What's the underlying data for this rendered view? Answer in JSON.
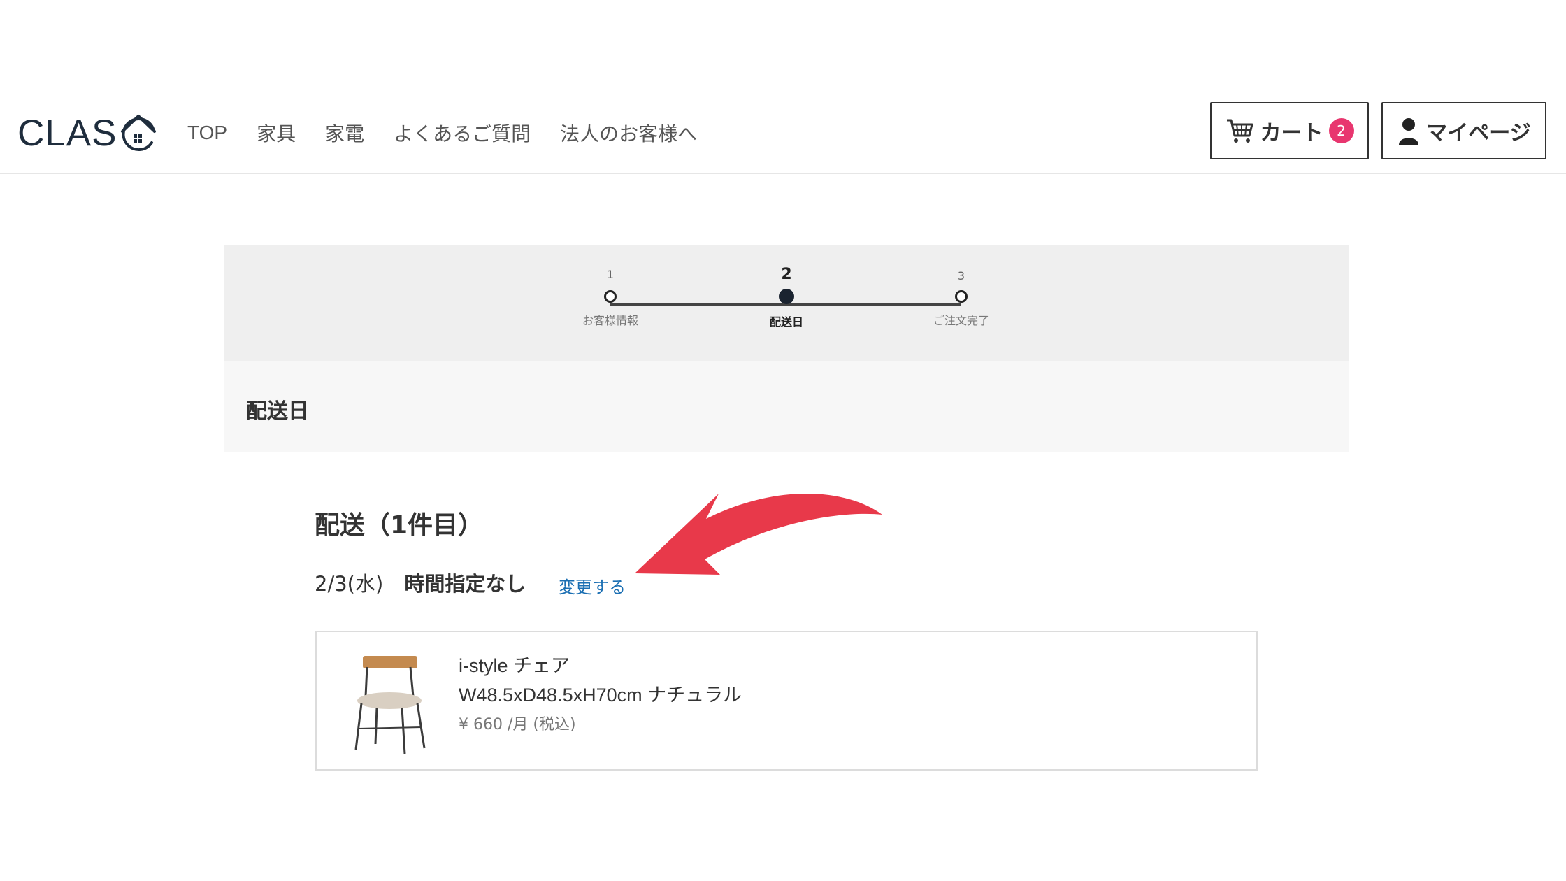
{
  "header": {
    "logo_text": "CLAS",
    "nav": [
      "TOP",
      "家具",
      "家電",
      "よくあるご質問",
      "法人のお客様へ"
    ],
    "cart_label": "カート",
    "cart_count": "2",
    "mypage_label": "マイページ"
  },
  "steps": [
    {
      "number": "1",
      "label": "お客様情報",
      "active": false
    },
    {
      "number": "2",
      "label": "配送日",
      "active": true
    },
    {
      "number": "3",
      "label": "ご注文完了",
      "active": false
    }
  ],
  "page": {
    "section_title": "配送日",
    "delivery_title": "配送（1件目）",
    "delivery_date": "2/3(水)",
    "delivery_time": "時間指定なし",
    "change_label": "変更する"
  },
  "product": {
    "name": "i-style チェア",
    "spec": "W48.5xD48.5xH70cm ナチュラル",
    "price": "¥ 660 /月 (税込)"
  },
  "colors": {
    "accent_badge": "#e8366f",
    "link": "#1b6fb3",
    "annotation_arrow": "#e8394a"
  }
}
